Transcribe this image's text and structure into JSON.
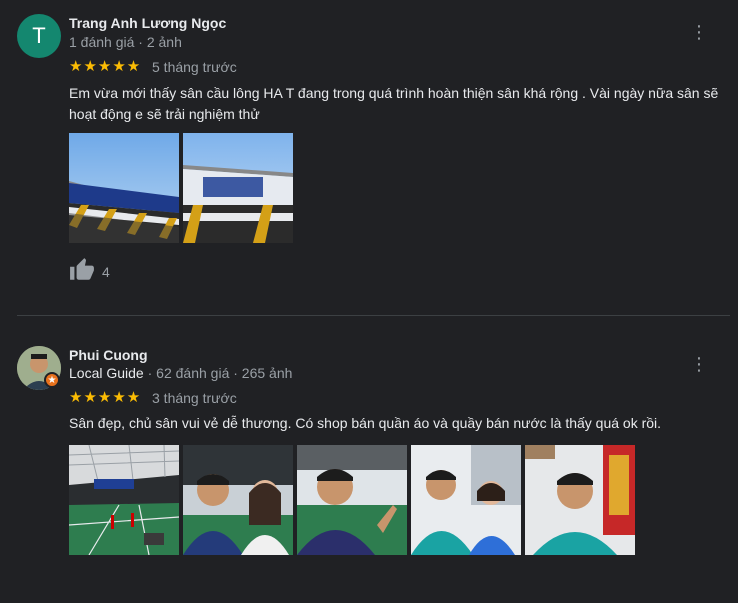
{
  "reviews": [
    {
      "avatar_letter": "T",
      "name": "Trang Anh Lương Ngọc",
      "meta": "1 đánh giá · 2 ảnh",
      "stars": "★★★★★",
      "time": "5 tháng trước",
      "text": "Em vừa mới thấy sân cầu  lông HA T đang trong quá trình hoàn thiện sân khá rộng . Vài ngày nữa sân sẽ hoạt động e sẽ trải nghiệm thử",
      "photos": [
        "court-banner-photo-1",
        "court-banner-photo-2"
      ],
      "likes": "4",
      "colors": {
        "avatar": "#14876f"
      }
    },
    {
      "name": "Phui Cuong",
      "local_guide": "Local Guide",
      "meta": "62 đánh giá · 265 ảnh",
      "stars": "★★★★★",
      "time": "3 tháng trước",
      "text": "Sân đẹp, chủ sân vui vẻ dễ thương. Có shop bán quần áo và quầy bán nước là thấy quá ok rồi.",
      "photos": [
        "indoor-court-photo",
        "selfie-photo-1",
        "selfie-photo-2",
        "selfie-photo-3",
        "selfie-photo-4"
      ]
    }
  ],
  "colors": {
    "background": "#202124",
    "star": "#fbbc04",
    "muted": "#9aa0a6",
    "local_guide_badge": "#e8711c"
  }
}
